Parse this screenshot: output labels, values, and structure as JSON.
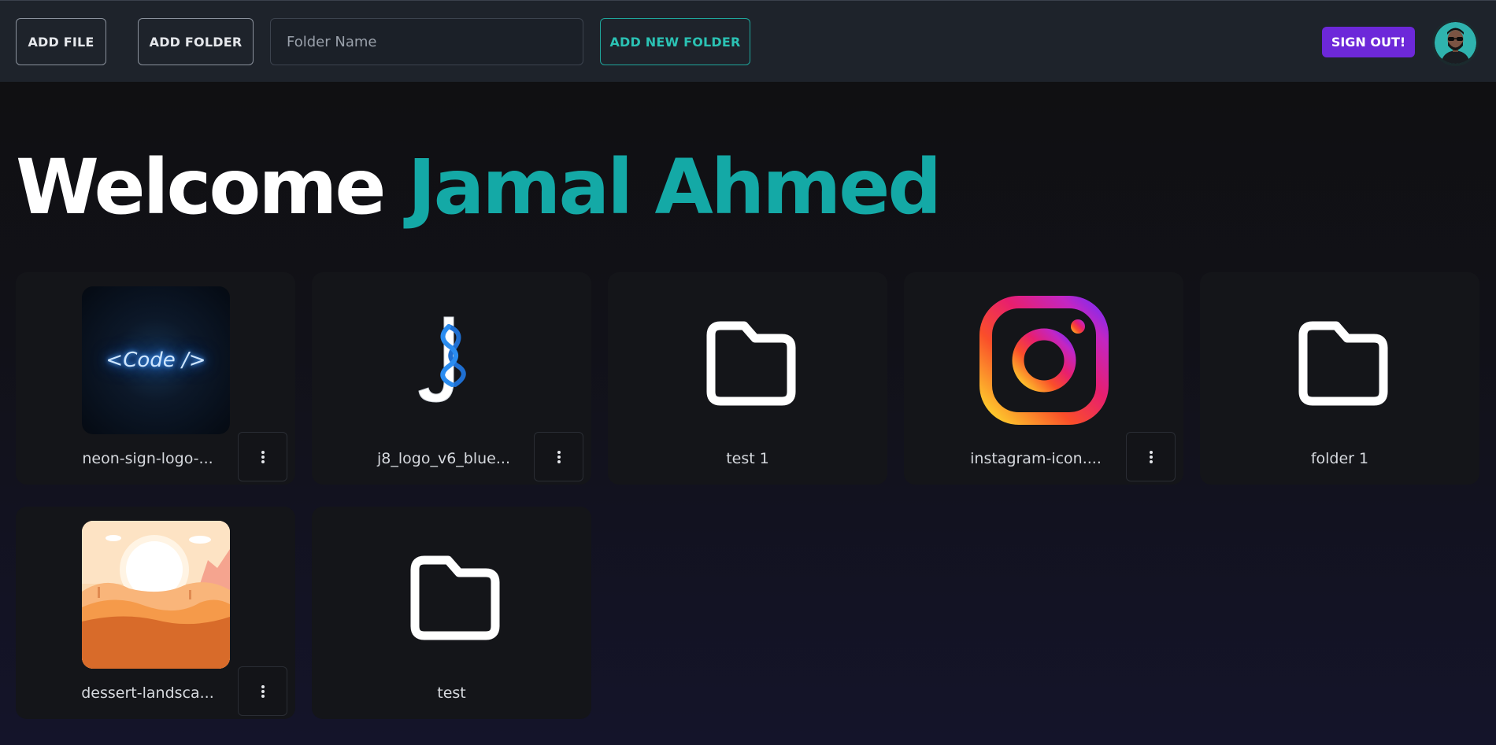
{
  "toolbar": {
    "add_file": "ADD FILE",
    "add_folder": "ADD FOLDER",
    "folder_name_placeholder": "Folder Name",
    "add_new_folder": "ADD NEW FOLDER",
    "sign_out": "SIGN OUT!"
  },
  "welcome": {
    "greeting": "Welcome",
    "user_name": "Jamal Ahmed"
  },
  "items": [
    {
      "type": "file",
      "name": "neon-sign-logo-...",
      "thumbnail": "neon-code-sign-image",
      "thumbnail_text": "<Code />",
      "has_menu": true
    },
    {
      "type": "file",
      "name": "j8_logo_v6_blue...",
      "thumbnail": "j8-logo-image",
      "has_menu": true
    },
    {
      "type": "folder",
      "name": "test 1",
      "icon": "folder-icon",
      "has_menu": false
    },
    {
      "type": "file",
      "name": "instagram-icon....",
      "thumbnail": "instagram-logo-image",
      "has_menu": true
    },
    {
      "type": "folder",
      "name": "folder 1",
      "icon": "folder-icon",
      "has_menu": false
    },
    {
      "type": "file",
      "name": "dessert-landsca...",
      "thumbnail": "desert-landscape-image",
      "has_menu": true
    },
    {
      "type": "folder",
      "name": "test",
      "icon": "folder-icon",
      "has_menu": false
    }
  ],
  "colors": {
    "accent": "#14a9a6",
    "sign_out_bg": "#6d28d9",
    "topbar_bg": "#1e232b"
  }
}
